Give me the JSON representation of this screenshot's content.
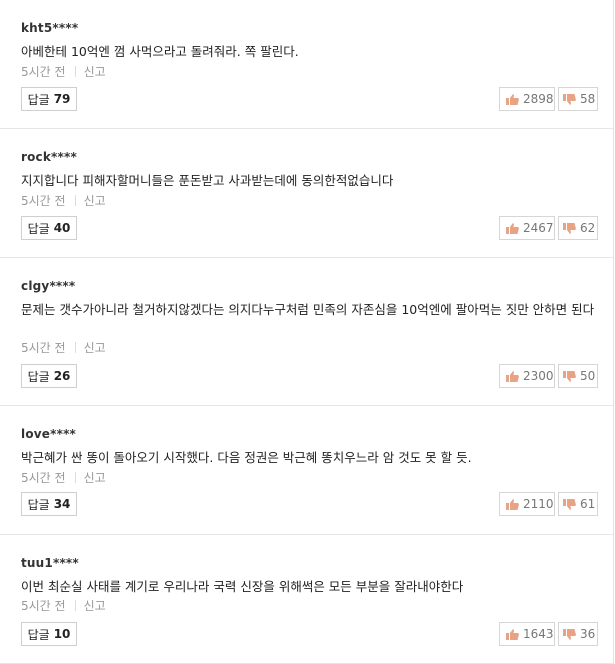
{
  "colors": {
    "thumb": "#e8a385",
    "border": "#cfcfcf",
    "meta": "#999999"
  },
  "icons": {
    "like": "thumbs-up-icon",
    "dislike": "thumbs-down-icon"
  },
  "comments": [
    {
      "author": "kht5****",
      "text": "아베한테 10억엔 껌 사먹으라고 돌려줘라. 쪽 팔린다.",
      "time": "5시간 전",
      "report": "신고",
      "reply_label": "답글",
      "reply_count": "79",
      "likes": "2898",
      "dislikes": "58"
    },
    {
      "author": "rock****",
      "text": "지지합니다 피해자할머니들은 푼돈받고 사과받는데에 동의한적없습니다",
      "time": "5시간 전",
      "report": "신고",
      "reply_label": "답글",
      "reply_count": "40",
      "likes": "2467",
      "dislikes": "62"
    },
    {
      "author": "clgy****",
      "text": "문제는 갯수가아니라 철거하지않겠다는 의지다누구처럼 민족의 자존심을 10억엔에 팔아먹는 짓만 안하면 된다",
      "time": "5시간 전",
      "report": "신고",
      "reply_label": "답글",
      "reply_count": "26",
      "likes": "2300",
      "dislikes": "50"
    },
    {
      "author": "love****",
      "text": "박근혜가 싼 똥이 돌아오기 시작했다. 다음 정권은 박근혜 똥치우느라 암 것도 못 할 듯.",
      "time": "5시간 전",
      "report": "신고",
      "reply_label": "답글",
      "reply_count": "34",
      "likes": "2110",
      "dislikes": "61"
    },
    {
      "author": "tuu1****",
      "text": "이번 최순실 사태를 계기로 우리나라 국력 신장을 위해썩은 모든 부분을 잘라내야한다",
      "time": "5시간 전",
      "report": "신고",
      "reply_label": "답글",
      "reply_count": "10",
      "likes": "1643",
      "dislikes": "36"
    }
  ]
}
